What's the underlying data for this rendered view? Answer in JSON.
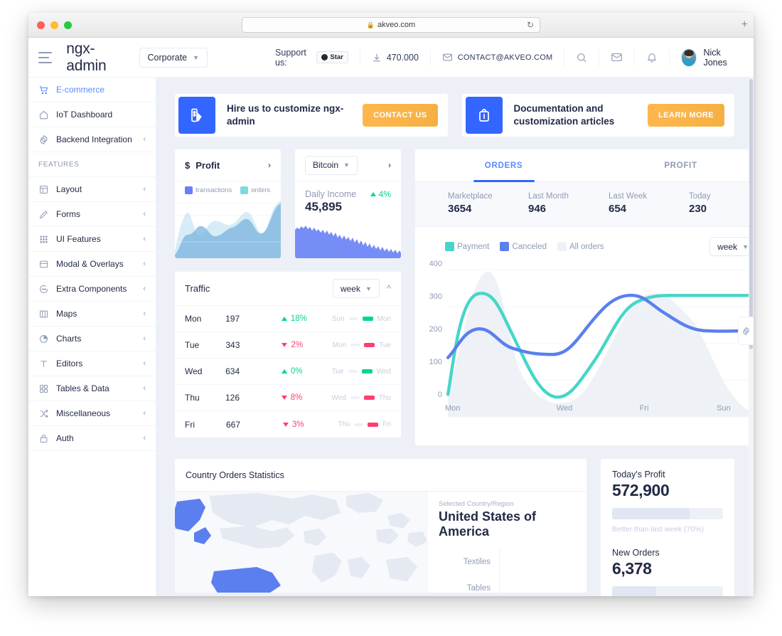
{
  "browser": {
    "url": "akveo.com",
    "lock_icon": "lock-icon",
    "reload_icon": "reload-icon",
    "newtab_icon": "plus-icon"
  },
  "header": {
    "menu_icon": "hamburger-icon",
    "brand": "ngx-admin",
    "theme": {
      "label": "Corporate",
      "chevron": "chevron-down-icon"
    },
    "support_label": "Support us:",
    "github_star_label": "Star",
    "downloads": {
      "icon": "download-icon",
      "count": "470.000"
    },
    "contact": {
      "icon": "mail-outline-icon",
      "text": "CONTACT@AKVEO.COM"
    },
    "search_icon": "search-icon",
    "envelope_icon": "email-icon",
    "bell_icon": "bell-icon",
    "user": {
      "name": "Nick Jones",
      "avatar": "user-avatar"
    }
  },
  "sidebar": {
    "items": [
      {
        "label": "E-commerce",
        "icon": "cart-icon",
        "active": true,
        "expandable": false
      },
      {
        "label": "IoT Dashboard",
        "icon": "home-icon",
        "active": false,
        "expandable": false
      },
      {
        "label": "Backend Integration",
        "icon": "gear-icon",
        "active": false,
        "expandable": true
      }
    ],
    "section_label": "FEATURES",
    "feature_items": [
      {
        "label": "Layout",
        "icon": "layout-icon",
        "expandable": true
      },
      {
        "label": "Forms",
        "icon": "pencil-icon",
        "expandable": true
      },
      {
        "label": "UI Features",
        "icon": "grid-icon",
        "expandable": true
      },
      {
        "label": "Modal & Overlays",
        "icon": "window-icon",
        "expandable": true
      },
      {
        "label": "Extra Components",
        "icon": "chat-bubble-icon",
        "expandable": true
      },
      {
        "label": "Maps",
        "icon": "map-icon",
        "expandable": true
      },
      {
        "label": "Charts",
        "icon": "pie-chart-icon",
        "expandable": true
      },
      {
        "label": "Editors",
        "icon": "text-icon",
        "expandable": true
      },
      {
        "label": "Tables & Data",
        "icon": "table-icon",
        "expandable": true
      },
      {
        "label": "Miscellaneous",
        "icon": "shuffle-icon",
        "expandable": true
      },
      {
        "label": "Auth",
        "icon": "lock-icon",
        "expandable": true
      }
    ]
  },
  "promos": [
    {
      "icon": "palette-icon",
      "text": "Hire us to customize ngx-admin",
      "button": "CONTACT US"
    },
    {
      "icon": "briefcase-icon",
      "text": "Documentation and customization articles",
      "button": "LEARN MORE"
    }
  ],
  "profit_card": {
    "currency_icon": "dollar-icon",
    "title": "Profit",
    "arrow_icon": "chevron-right-icon",
    "legend": [
      {
        "label": "transactions",
        "color": "#6a7efc"
      },
      {
        "label": "orders",
        "color": "#7ed8e0"
      }
    ],
    "chart_data": {
      "type": "area",
      "title": "Profit",
      "series": [
        {
          "name": "transactions",
          "color": "#6a7efc",
          "values": [
            12,
            55,
            30,
            50,
            18,
            40,
            62,
            50,
            78,
            45,
            95
          ]
        },
        {
          "name": "orders",
          "color": "#7ed8e0",
          "values": [
            5,
            70,
            20,
            38,
            30,
            52,
            48,
            60,
            44,
            62,
            100
          ]
        }
      ],
      "grid": true,
      "ylim": [
        0,
        100
      ]
    }
  },
  "bitcoin_card": {
    "select": {
      "label": "Bitcoin",
      "chevron": "chevron-down-icon"
    },
    "arrow_icon": "chevron-right-icon",
    "income_label": "Daily Income",
    "delta": "4%",
    "delta_direction": "up",
    "delta_color": "#00d68f",
    "value": "45,895",
    "chart_data": {
      "type": "area",
      "title": "Daily Income",
      "values": [
        62,
        70,
        66,
        72,
        64,
        70,
        60,
        66,
        58,
        62,
        55,
        58,
        50,
        54,
        46,
        50,
        42,
        46,
        38,
        42,
        34,
        40,
        30,
        36,
        28,
        34,
        26,
        30,
        22,
        28,
        20,
        26,
        18,
        22,
        14,
        20,
        12,
        16,
        10,
        14
      ],
      "color": "#6a83f7"
    }
  },
  "traffic": {
    "title": "Traffic",
    "period": {
      "label": "week",
      "chevron": "chevron-down-icon"
    },
    "collapse_icon": "chevron-up-icon",
    "rows": [
      {
        "day": "Mon",
        "value": "197",
        "delta": "18%",
        "dir": "up",
        "from": "Sun",
        "to": "Mon"
      },
      {
        "day": "Tue",
        "value": "343",
        "delta": "2%",
        "dir": "down",
        "from": "Mon",
        "to": "Tue"
      },
      {
        "day": "Wed",
        "value": "634",
        "delta": "0%",
        "dir": "up",
        "from": "Tue",
        "to": "Wed"
      },
      {
        "day": "Thu",
        "value": "126",
        "delta": "8%",
        "dir": "down",
        "from": "Wed",
        "to": "Thu"
      },
      {
        "day": "Fri",
        "value": "667",
        "delta": "3%",
        "dir": "down",
        "from": "Thu",
        "to": "Fri"
      }
    ]
  },
  "orders_card": {
    "tabs": [
      {
        "label": "ORDERS",
        "active": true
      },
      {
        "label": "PROFIT",
        "active": false
      }
    ],
    "kpis": [
      {
        "label": "Marketplace",
        "value": "3654"
      },
      {
        "label": "Last Month",
        "value": "946"
      },
      {
        "label": "Last Week",
        "value": "654"
      },
      {
        "label": "Today",
        "value": "230"
      }
    ],
    "legend": [
      {
        "label": "Payment",
        "color": "#46d6c8"
      },
      {
        "label": "Canceled",
        "color": "#5b7fee"
      },
      {
        "label": "All orders",
        "color": "#eef1f6"
      }
    ],
    "period": {
      "label": "week",
      "chevron": "chevron-down-icon"
    },
    "chart_data": {
      "type": "line",
      "title": "Orders",
      "x": [
        "Mon",
        "Tue",
        "Wed",
        "Thu",
        "Fri",
        "Sat",
        "Sun",
        ""
      ],
      "xticks": [
        "Mon",
        "Wed",
        "Fri",
        "Sun"
      ],
      "yticks": [
        0,
        100,
        200,
        300,
        400
      ],
      "ylim": [
        0,
        420
      ],
      "grid": true,
      "series": [
        {
          "name": "Payment",
          "color": "#46d6c8",
          "values": [
            60,
            325,
            160,
            58,
            120,
            265,
            298,
            298
          ]
        },
        {
          "name": "Canceled",
          "color": "#5b7fee",
          "values": [
            160,
            212,
            160,
            172,
            305,
            285,
            232,
            232
          ]
        },
        {
          "name": "All orders",
          "color": "#eef1f6",
          "values": [
            120,
            398,
            130,
            72,
            190,
            340,
            250,
            90
          ]
        }
      ]
    }
  },
  "country_card": {
    "title": "Country Orders Statistics",
    "selected_label": "Selected Country/Region",
    "country": "United States of America",
    "categories": [
      "Textiles",
      "Tables"
    ]
  },
  "side_stats": [
    {
      "label": "Today's Profit",
      "value": "572,900",
      "progress": 70,
      "note": "Better than last week (70%)"
    },
    {
      "label": "New Orders",
      "value": "6,378",
      "progress": 40,
      "note": ""
    }
  ],
  "settings_tab_icon": "gear-icon"
}
